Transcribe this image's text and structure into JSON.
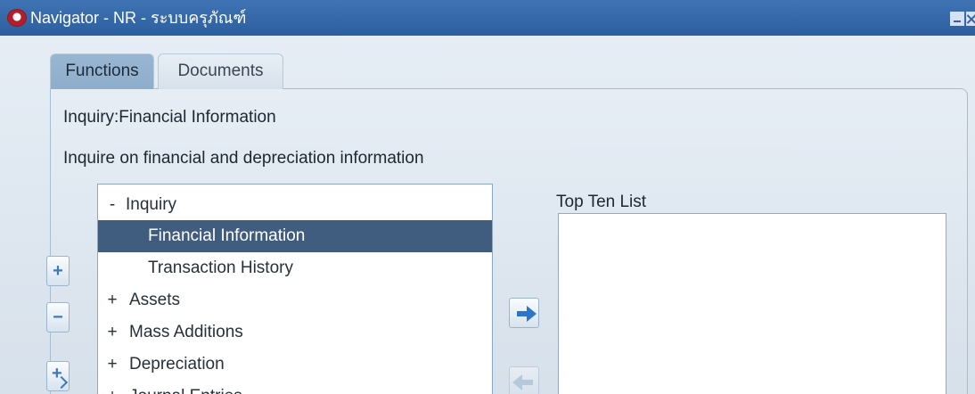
{
  "window": {
    "title": "Navigator - NR - ระบบครุภัณฑ์"
  },
  "tabs": [
    {
      "label": "Functions",
      "active": true
    },
    {
      "label": "Documents",
      "active": false
    }
  ],
  "content": {
    "function_path": "Inquiry:Financial Information",
    "description": "Inquire on financial and depreciation information"
  },
  "tree": {
    "items": [
      {
        "toggle": "-",
        "label": "Inquiry"
      },
      {
        "toggle": "",
        "label": "Financial Information",
        "selected": true
      },
      {
        "toggle": "",
        "label": "Transaction History"
      },
      {
        "toggle": "+",
        "label": "Assets"
      },
      {
        "toggle": "+",
        "label": "Mass Additions"
      },
      {
        "toggle": "+",
        "label": "Depreciation"
      },
      {
        "toggle": "+",
        "label": "Journal Entries"
      }
    ]
  },
  "top_ten": {
    "label": "Top Ten List",
    "items": []
  },
  "icons": {
    "app_icon": "oracle-app-icon",
    "expand": "plus-icon",
    "collapse": "minus-icon",
    "expand_all": "expand-all-icon",
    "add_to_list": "arrow-right-icon",
    "remove_from_list": "arrow-left-icon"
  },
  "colors": {
    "titlebar": "#3568aa",
    "active_tab": "#93b2cf",
    "selected_row": "#405c7f",
    "accent": "#2c74c8"
  }
}
